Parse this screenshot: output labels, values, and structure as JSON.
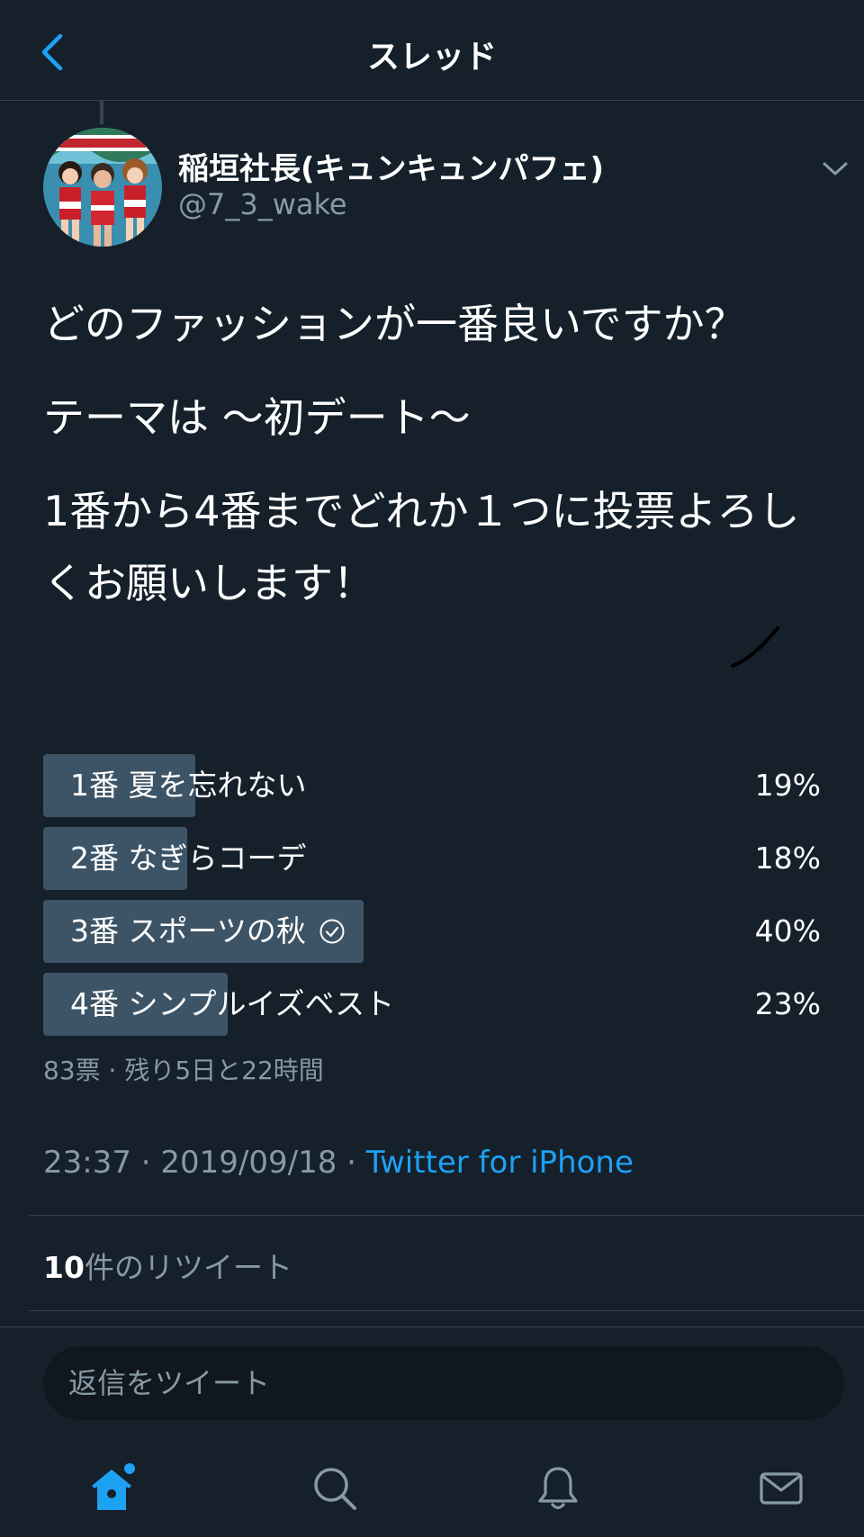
{
  "header": {
    "title": "スレッド"
  },
  "author": {
    "display_name": "稲垣社長(キュンキュンパフェ)",
    "handle": "@7_3_wake"
  },
  "tweet": {
    "lines": [
      "どのファッションが一番良いですか？",
      "テーマは 〜初デート〜",
      "1番から4番までどれか１つに投票よろしくお願いします！"
    ]
  },
  "poll": {
    "options": [
      {
        "label": "1番 夏を忘れない",
        "percent_text": "19%",
        "percent": 19,
        "selected": false
      },
      {
        "label": "2番 なぎらコーデ",
        "percent_text": "18%",
        "percent": 18,
        "selected": false
      },
      {
        "label": "3番 スポーツの秋",
        "percent_text": "40%",
        "percent": 40,
        "selected": true
      },
      {
        "label": "4番 シンプルイズベスト",
        "percent_text": "23%",
        "percent": 23,
        "selected": false
      }
    ],
    "meta": "83票 · 残り5日と22時間"
  },
  "footer": {
    "time": "23:37 · 2019/09/18 · ",
    "source": "Twitter for iPhone",
    "retweet_count": "10",
    "retweet_label": "件のリツイート"
  },
  "reply": {
    "placeholder": "返信をツイート"
  },
  "tabbar": {
    "icons": [
      "home-icon",
      "search-icon",
      "notifications-icon",
      "messages-icon"
    ]
  },
  "colors": {
    "background": "#15202b",
    "accent": "#1da1f2",
    "poll_fill": "#3d5466",
    "muted_text": "#8899a6"
  }
}
